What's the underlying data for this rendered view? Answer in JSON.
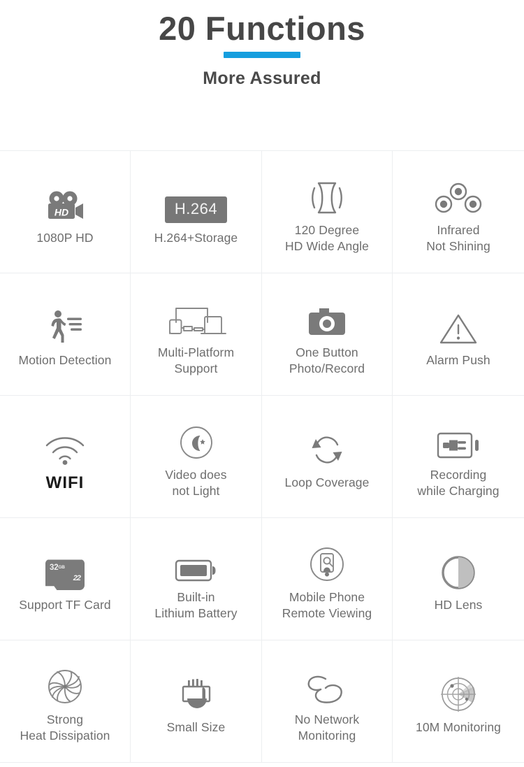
{
  "header": {
    "title": "20 Functions",
    "subtitle": "More Assured",
    "accent_color": "#169ede",
    "title_color": "#474747"
  },
  "grid": {
    "columns": 4,
    "rows": 5,
    "label_color": "#6e6e6e",
    "border_color": "#eceef0",
    "icon_color": "#7a7a7a",
    "cells": [
      {
        "icon": "video-camera-hd-icon",
        "label_line1": "1080P HD",
        "label_line2": ""
      },
      {
        "icon": "h264-badge-icon",
        "badge_text": "H.264",
        "label_line1": "H.264+Storage",
        "label_line2": ""
      },
      {
        "icon": "wide-angle-icon",
        "label_line1": "120 Degree",
        "label_line2": "HD Wide Angle"
      },
      {
        "icon": "infrared-leds-icon",
        "label_line1": "Infrared",
        "label_line2": "Not Shining"
      },
      {
        "icon": "motion-detection-icon",
        "label_line1": "Motion Detection",
        "label_line2": ""
      },
      {
        "icon": "multi-platform-devices-icon",
        "label_line1": "Multi-Platform",
        "label_line2": "Support"
      },
      {
        "icon": "photo-camera-icon",
        "label_line1": "One Button",
        "label_line2": "Photo/Record"
      },
      {
        "icon": "alarm-warning-triangle-icon",
        "label_line1": "Alarm Push",
        "label_line2": ""
      },
      {
        "icon": "wifi-icon",
        "label_line1": "WIFI",
        "label_line2": "",
        "label_style": "dark"
      },
      {
        "icon": "moon-night-icon",
        "label_line1": "Video does",
        "label_line2": "not Light"
      },
      {
        "icon": "loop-refresh-icon",
        "label_line1": "Loop Coverage",
        "label_line2": ""
      },
      {
        "icon": "battery-charging-plug-icon",
        "label_line1": "Recording",
        "label_line2": "while Charging"
      },
      {
        "icon": "tf-memory-card-icon",
        "card_capacity": "32",
        "card_unit": "GB",
        "label_line1": "Support TF Card",
        "label_line2": ""
      },
      {
        "icon": "battery-icon",
        "label_line1": "Built-in",
        "label_line2": "Lithium Battery"
      },
      {
        "icon": "mobile-remote-view-icon",
        "label_line1": "Mobile Phone",
        "label_line2": "Remote Viewing"
      },
      {
        "icon": "hd-lens-icon",
        "label_line1": "HD Lens",
        "label_line2": ""
      },
      {
        "icon": "cooling-fan-icon",
        "label_line1": "Strong",
        "label_line2": "Heat Dissipation"
      },
      {
        "icon": "small-size-hand-icon",
        "label_line1": "Small Size",
        "label_line2": ""
      },
      {
        "icon": "no-network-link-icon",
        "label_line1": "No Network",
        "label_line2": "Monitoring"
      },
      {
        "icon": "radar-monitoring-icon",
        "label_line1": "10M Monitoring",
        "label_line2": ""
      }
    ]
  }
}
